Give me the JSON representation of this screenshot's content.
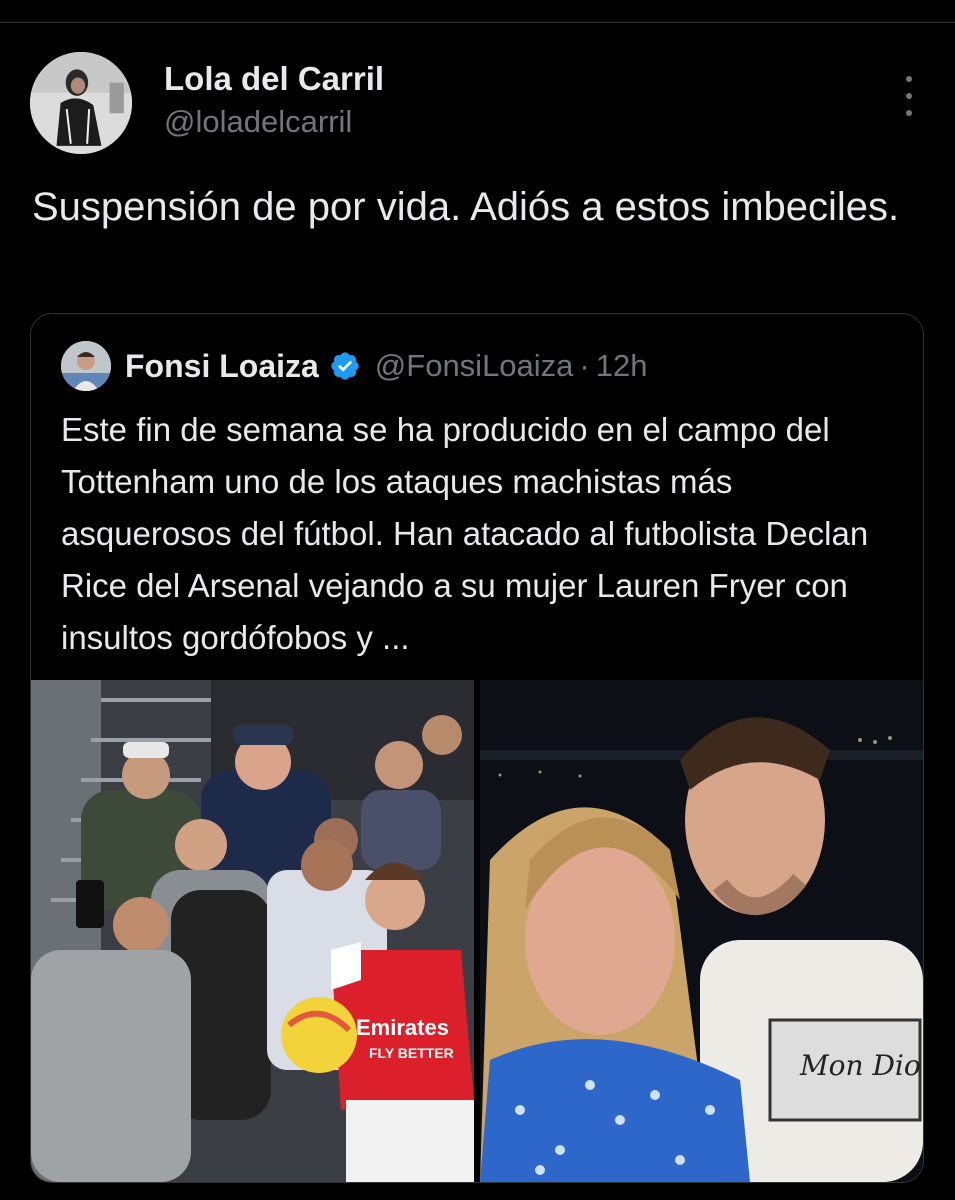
{
  "tweet": {
    "author_name": "Lola del Carril",
    "author_handle": "@loladelcarril",
    "more_icon": "more-vertical-icon",
    "text": "Suspensión de por vida. Adiós a estos imbeciles."
  },
  "quoted_tweet": {
    "author_name": "Fonsi Loaiza",
    "verified_icon": "verified-badge-icon",
    "author_handle": "@FonsiLoaiza",
    "separator": "·",
    "time": "12h",
    "text": "Este fin de semana se ha producido en el campo del Tottenham uno de los ataques machistas más asquerosos del fútbol. Han atacado al futbolista Declan Rice del Arsenal vejando a su mujer Lauren Fryer con insultos gordófobos y ...",
    "media": [
      {
        "alt_icon": "stadium-crowd-photo"
      },
      {
        "alt_icon": "couple-selfie-photo"
      }
    ]
  },
  "colors": {
    "background": "#000000",
    "text": "#e7e9ea",
    "muted": "#71767b",
    "border": "#2f3336",
    "verified": "#1d9bf0"
  }
}
